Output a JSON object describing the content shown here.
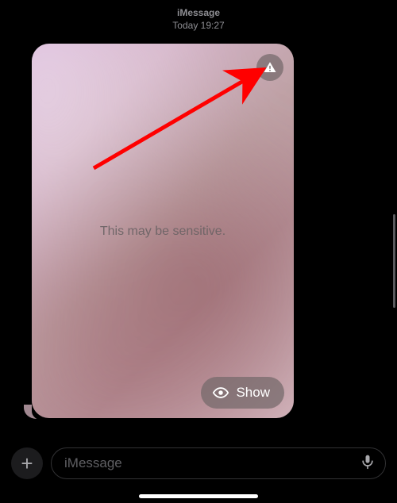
{
  "header": {
    "service": "iMessage",
    "timestamp": "Today 19:27"
  },
  "bubble": {
    "sensitive_label": "This may be sensitive.",
    "show_label": "Show"
  },
  "input": {
    "placeholder": "iMessage"
  },
  "icons": {
    "warning": "exclamation-triangle",
    "eye": "eye",
    "plus": "plus",
    "mic": "microphone"
  },
  "annotation": {
    "arrow_color": "#ff0000"
  }
}
